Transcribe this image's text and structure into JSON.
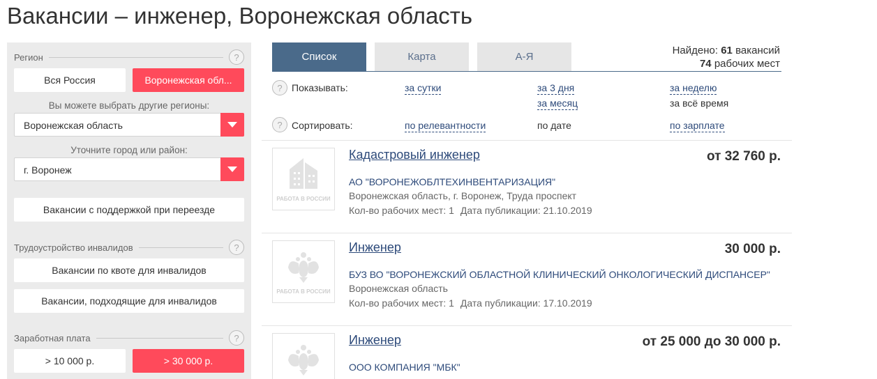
{
  "page": {
    "title": "Вакансии – инженер, Воронежская область"
  },
  "sidebar": {
    "region": {
      "label": "Регион",
      "help": "?",
      "btn_all": "Вся Россия",
      "btn_selected": "Воронежская обл...",
      "hint_region": "Вы можете выбрать другие регионы:",
      "region_value": "Воронежская область",
      "hint_city": "Уточните город или район:",
      "city_value": "г. Воронеж",
      "relocation_button": "Вакансии с поддержкой при переезде"
    },
    "disabled": {
      "label": "Трудоустройство инвалидов",
      "help": "?",
      "quota_button": "Вакансии по квоте для инвалидов",
      "suitable_button": "Вакансии, подходящие для инвалидов"
    },
    "salary": {
      "label": "Заработная плата",
      "help": "?",
      "btn_10000": "> 10 000 р.",
      "btn_30000": "> 30 000 р."
    }
  },
  "tabs": [
    {
      "label": "Список",
      "active": true
    },
    {
      "label": "Карта",
      "active": false
    },
    {
      "label": "А-Я",
      "active": false
    }
  ],
  "found": {
    "prefix": "Найдено:",
    "vacancies_count": "61",
    "vacancies_word": "вакансий",
    "places_count": "74",
    "places_word": "рабочих мест"
  },
  "filters": {
    "help": "?",
    "show_label": "Показывать:",
    "show_day": "за сутки",
    "show_3days": "за 3 дня",
    "show_week": "за неделю",
    "show_month": "за месяц",
    "show_all": "за всё время",
    "sort_label": "Сортировать:",
    "sort_relevance": "по релевантности",
    "sort_date": "по дате",
    "sort_salary": "по зарплате"
  },
  "vacancies": [
    {
      "title": "Кадастровый инженер",
      "salary": "от 32 760 р.",
      "company": "АО \"ВОРОНЕЖОБЛТЕХИНВЕНТАРИЗАЦИЯ\"",
      "address": "Воронежская область, г. Воронеж, Труда проспект",
      "places": "Кол-во рабочих мест: 1",
      "published": "Дата публикации: 21.10.2019",
      "logo": "building-logo",
      "logo_text": "РАБОТА В РОССИИ"
    },
    {
      "title": "Инженер",
      "salary": "30 000 р.",
      "company": "БУЗ ВО \"ВОРОНЕЖСКИЙ ОБЛАСТНОЙ КЛИНИЧЕСКИЙ ОНКОЛОГИЧЕСКИЙ ДИСПАНСЕР\"",
      "address": "Воронежская область",
      "places": "Кол-во рабочих мест: 1",
      "published": "Дата публикации: 17.10.2019",
      "logo": "eagle-logo",
      "logo_text": "РАБОТА В РОССИИ"
    },
    {
      "title": "Инженер",
      "salary": "от 25 000 до 30 000 р.",
      "company": "ООО КОМПАНИЯ \"МБК\"",
      "logo": "eagle-logo"
    }
  ],
  "colors": {
    "accent_red": "#ff4a5b",
    "tab_active": "#4a6a8a",
    "link_blue": "#2d4a7a",
    "sidebar_bg": "#ebebeb"
  }
}
